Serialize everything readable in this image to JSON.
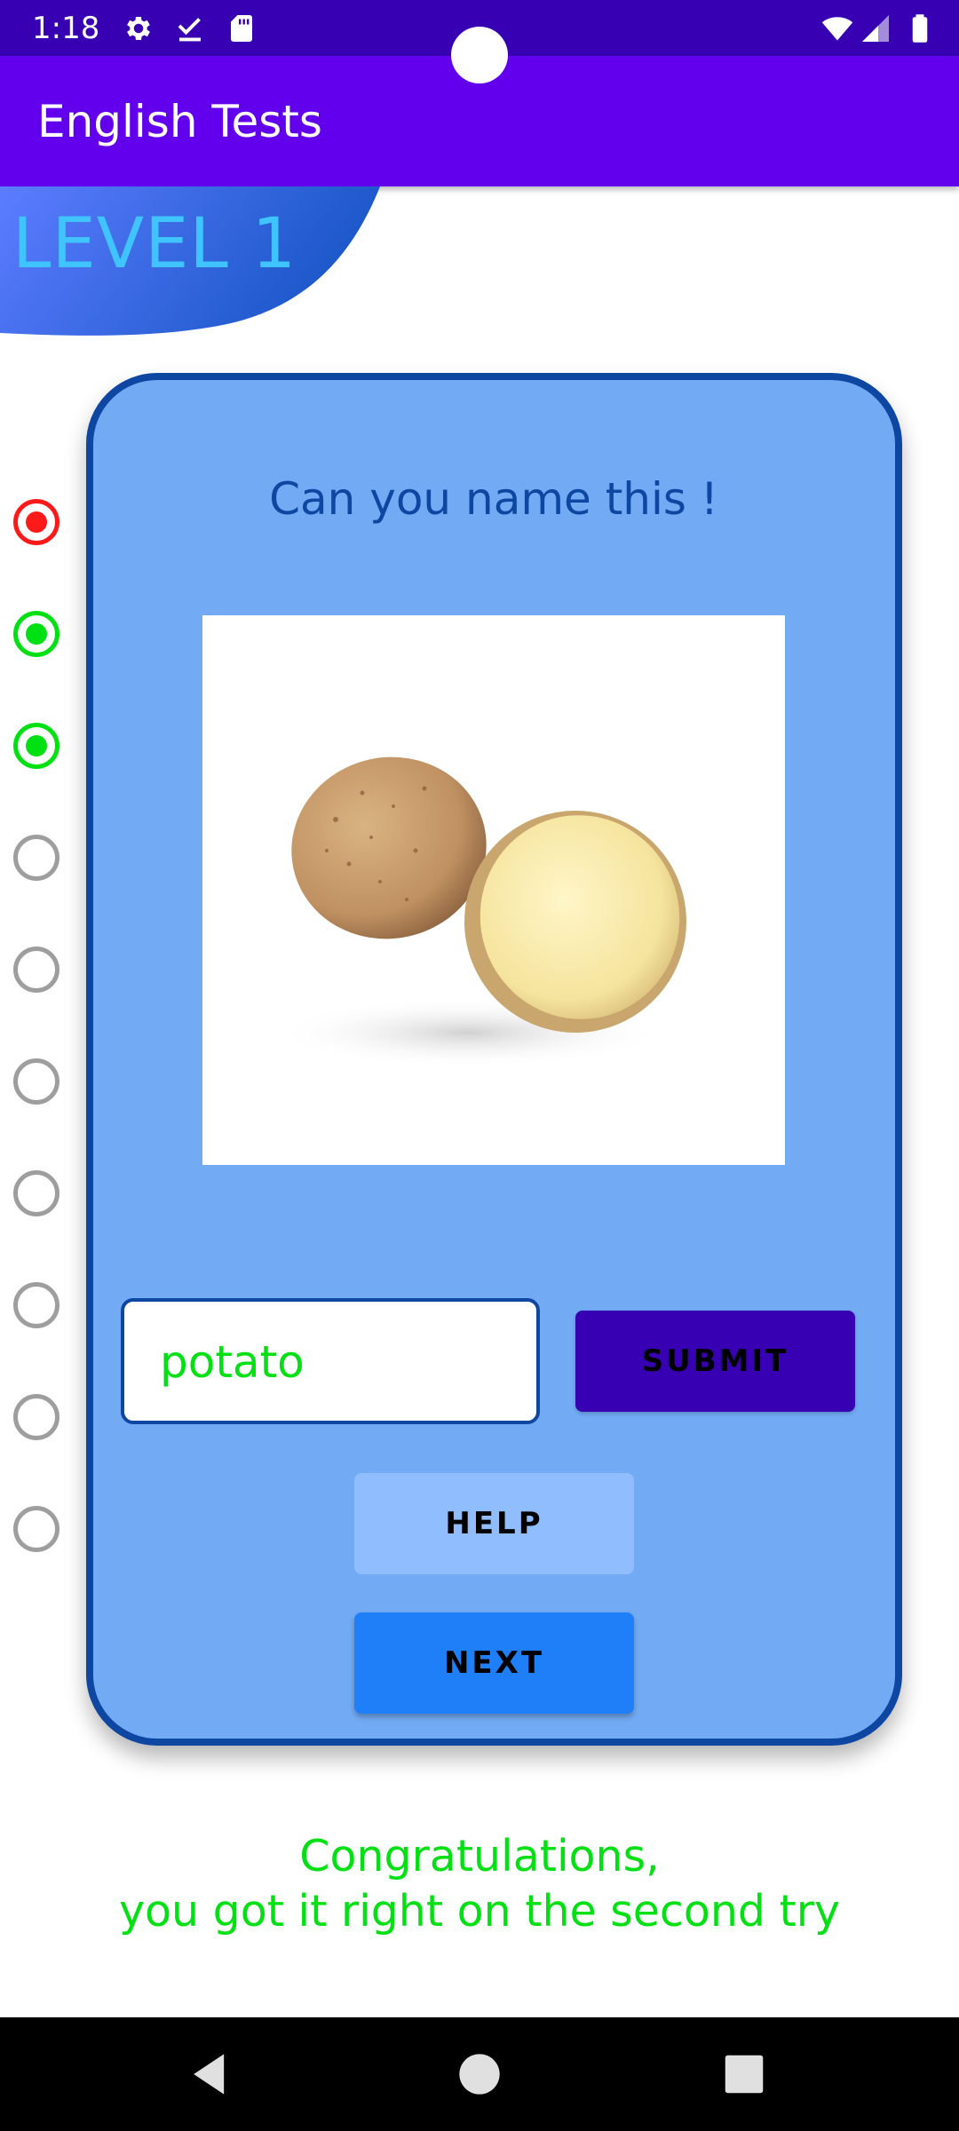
{
  "status_bar": {
    "time": "1:18",
    "icons": [
      "settings-icon",
      "download-done-icon",
      "sd-card-icon",
      "wifi-icon",
      "signal-icon",
      "battery-icon"
    ]
  },
  "app_bar": {
    "title": "English Tests"
  },
  "level": {
    "label": "LEVEL 1"
  },
  "progress": {
    "total": 10,
    "states": [
      "wrong",
      "correct",
      "correct",
      "empty",
      "empty",
      "empty",
      "empty",
      "empty",
      "empty",
      "empty"
    ]
  },
  "card": {
    "question": "Can you name this !",
    "image": "potato-image",
    "answer_value": "potato",
    "submit_label": "SUBMIT",
    "help_label": "HELP",
    "next_label": "NEXT"
  },
  "feedback": {
    "line1": "Congratulations,",
    "line2": "you got it right on the second try"
  },
  "colors": {
    "status_bar": "#3700b3",
    "app_bar": "#6200ee",
    "card_bg": "#72aaf3",
    "card_border": "#0d47a1",
    "radio_wrong": "#ff1a1a",
    "radio_correct": "#00e012",
    "radio_empty": "#9e9e9e",
    "level_text": "#40c4ff",
    "feedback_text": "#00e012",
    "submit_bg": "#3700b3",
    "help_bg": "#90bdfd",
    "next_bg": "#1e7ff8"
  },
  "nav_bar": {
    "buttons": [
      "back-icon",
      "home-icon",
      "recents-icon"
    ]
  }
}
